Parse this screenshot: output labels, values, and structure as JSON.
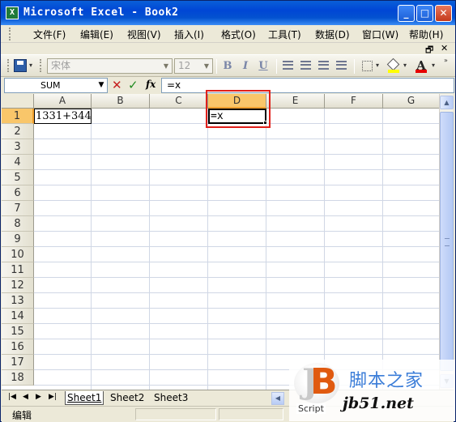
{
  "window": {
    "title": "Microsoft Excel - Book2",
    "icon_label": "X",
    "minimize": "_",
    "maximize": "□",
    "close": "✕"
  },
  "menu": {
    "items": [
      "文件(F)",
      "编辑(E)",
      "视图(V)",
      "插入(I)",
      "格式(O)",
      "工具(T)",
      "数据(D)",
      "窗口(W)",
      "帮助(H)"
    ],
    "doc_restore": "🗗",
    "doc_close": "✕"
  },
  "toolbar": {
    "font_name": "宋体",
    "font_size": "12",
    "bold": "B",
    "italic": "I",
    "underline": "U",
    "font_color_glyph": "A",
    "fill_color": "#ffff00",
    "font_color": "#e50000"
  },
  "formula_bar": {
    "name_box": "SUM",
    "cancel": "✕",
    "enter": "✓",
    "insert_function": "fx",
    "content": "=x"
  },
  "grid": {
    "columns": [
      "A",
      "B",
      "C",
      "D",
      "E",
      "F",
      "G"
    ],
    "active_column": "D",
    "rows": [
      "1",
      "2",
      "3",
      "4",
      "5",
      "6",
      "7",
      "8",
      "9",
      "10",
      "11",
      "12",
      "13",
      "14",
      "15",
      "16",
      "17",
      "18"
    ],
    "active_row": "1",
    "cells": {
      "A1": "1331+344",
      "D1": "=x"
    }
  },
  "sheets": {
    "tabs": [
      "Sheet1",
      "Sheet2",
      "Sheet3"
    ],
    "active": "Sheet1",
    "nav": [
      "|◀",
      "◀",
      "▶",
      "▶|"
    ]
  },
  "status": {
    "mode": "编辑"
  },
  "watermark": {
    "site_name": "脚本之家",
    "url": "jb51.net",
    "tag": "Script",
    "logo_letter_j": "J",
    "logo_letter_b": "B"
  }
}
